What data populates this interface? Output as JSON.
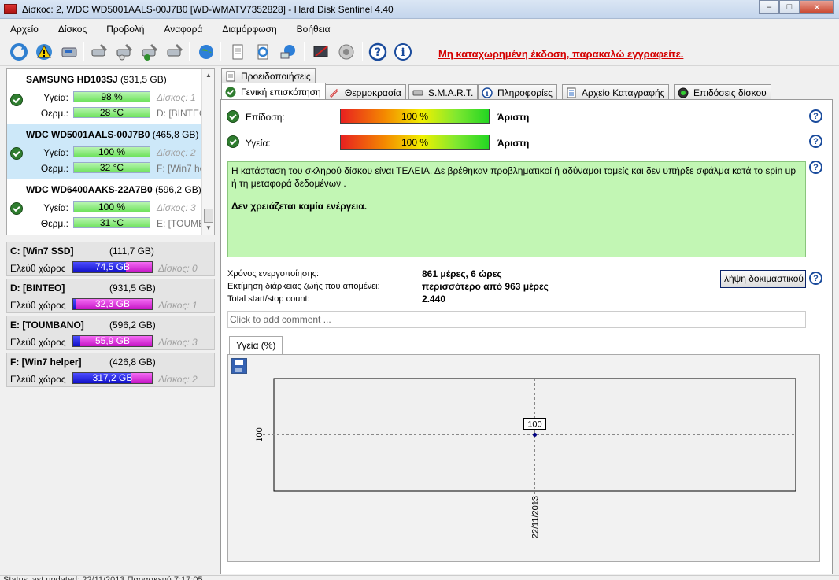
{
  "window": {
    "title": "Δίσκος: 2, WDC WD5001AALS-00J7B0 [WD-WMATV7352828]  -  Hard Disk Sentinel 4.40",
    "minimize": "–",
    "maximize": "□",
    "close": "✕"
  },
  "menu": [
    "Αρχείο",
    "Δίσκος",
    "Προβολή",
    "Αναφορά",
    "Διαμόρφωση",
    "Βοήθεια"
  ],
  "toolbar": {
    "register_link": "Μη καταχωρημένη έκδοση, παρακαλώ εγγραφείτε."
  },
  "disks": [
    {
      "model": "SAMSUNG HD103SJ",
      "size": "(931,5 GB)",
      "health_label": "Υγεία:",
      "health": "98 %",
      "temp_label": "Θερμ.:",
      "temp": "28 °C",
      "disk_ref": "Δίσκος: 1",
      "drive_ref": "D: [BINTEO]"
    },
    {
      "model": "WDC WD5001AALS-00J7B0",
      "size": "(465,8 GB)",
      "health_label": "Υγεία:",
      "health": "100 %",
      "temp_label": "Θερμ.:",
      "temp": "32 °C",
      "disk_ref": "Δίσκος: 2",
      "drive_ref": "F: [Win7 helper]"
    },
    {
      "model": "WDC WD6400AAKS-22A7B0",
      "size": "(596,2 GB)",
      "health_label": "Υγεία:",
      "health": "100 %",
      "temp_label": "Θερμ.:",
      "temp": "31 °C",
      "disk_ref": "Δίσκος: 3",
      "drive_ref": "E: [TOUMBANO]"
    }
  ],
  "partitions": [
    {
      "name": "C: [Win7 SSD]",
      "size": "(111,7 GB)",
      "free_label": "Ελεύθ χώρος",
      "free": "74,5 GB",
      "free_fraction": 0.667,
      "disk_ref": "Δίσκος: 0"
    },
    {
      "name": "D: [BINTEO]",
      "size": "(931,5 GB)",
      "free_label": "Ελεύθ χώρος",
      "free": "32,3 GB",
      "free_fraction": 0.035,
      "disk_ref": "Δίσκος: 1"
    },
    {
      "name": "E: [TOUMBANO]",
      "size": "(596,2 GB)",
      "free_label": "Ελεύθ χώρος",
      "free": "55,9 GB",
      "free_fraction": 0.094,
      "disk_ref": "Δίσκος: 3"
    },
    {
      "name": "F: [Win7 helper]",
      "size": "(426,8 GB)",
      "free_label": "Ελεύθ χώρος",
      "free": "317,2 GB",
      "free_fraction": 0.743,
      "disk_ref": "Δίσκος: 2"
    }
  ],
  "tabs": {
    "alerts": "Προειδοποιήσεις",
    "overview": "Γενική επισκόπηση",
    "temperature": "Θερμοκρασία",
    "smart": "S.M.A.R.T.",
    "info": "Πληροφορίες",
    "log": "Αρχείο Καταγραφής",
    "performance": "Επιδόσεις δίσκου"
  },
  "overview": {
    "performance_label": "Επίδοση:",
    "performance_value": "100 %",
    "performance_fraction": 1.0,
    "performance_status": "Άριστη",
    "health_label": "Υγεία:",
    "health_value": "100 %",
    "health_fraction": 1.0,
    "health_status": "Άριστη",
    "status_text": "Η κατάσταση του σκληρού δίσκου είναι ΤΕΛΕΙΑ. Δε βρέθηκαν προβληματικοί ή αδύναμοι τομείς και δεν υπήρξε σφάλμα κατά το spin up ή τη μεταφορά δεδομένων .",
    "action_text": "Δεν χρειάζεται καμία ενέργεια.",
    "power_on_label": "Χρόνος ενεργοποίησης:",
    "power_on_value": "861 μέρες, 6 ώρες",
    "lifetime_label": "Εκτίμηση διάρκειας ζωής που απομένει:",
    "lifetime_value": "περισσότερο από 963 μέρες",
    "startstop_label": "Total start/stop count:",
    "startstop_value": "2.440",
    "test_button": "λήψη δοκιμαστικού",
    "comment_placeholder": "Click to add comment ..."
  },
  "chart_tab": "Υγεία (%)",
  "chart_data": {
    "type": "scatter",
    "x": [
      "22/11/2013"
    ],
    "y": [
      100
    ],
    "data_labels": [
      "100"
    ],
    "title": "",
    "xlabel": "",
    "ylabel": "",
    "ytick_label": "100",
    "grid": true
  },
  "statusbar": "Status last updated: 22/11/2013 Παρασκευή 7:17:05"
}
